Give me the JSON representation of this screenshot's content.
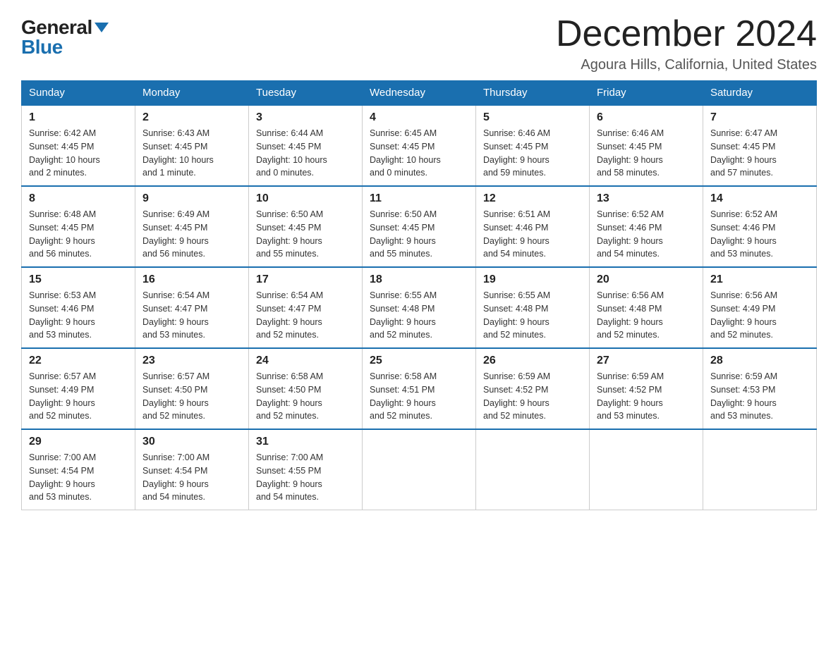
{
  "header": {
    "logo_general": "General",
    "logo_blue": "Blue",
    "title": "December 2024",
    "subtitle": "Agoura Hills, California, United States"
  },
  "days_of_week": [
    "Sunday",
    "Monday",
    "Tuesday",
    "Wednesday",
    "Thursday",
    "Friday",
    "Saturday"
  ],
  "weeks": [
    [
      {
        "day": "1",
        "sunrise": "6:42 AM",
        "sunset": "4:45 PM",
        "daylight": "10 hours",
        "daylight2": "and 2 minutes."
      },
      {
        "day": "2",
        "sunrise": "6:43 AM",
        "sunset": "4:45 PM",
        "daylight": "10 hours",
        "daylight2": "and 1 minute."
      },
      {
        "day": "3",
        "sunrise": "6:44 AM",
        "sunset": "4:45 PM",
        "daylight": "10 hours",
        "daylight2": "and 0 minutes."
      },
      {
        "day": "4",
        "sunrise": "6:45 AM",
        "sunset": "4:45 PM",
        "daylight": "10 hours",
        "daylight2": "and 0 minutes."
      },
      {
        "day": "5",
        "sunrise": "6:46 AM",
        "sunset": "4:45 PM",
        "daylight": "9 hours",
        "daylight2": "and 59 minutes."
      },
      {
        "day": "6",
        "sunrise": "6:46 AM",
        "sunset": "4:45 PM",
        "daylight": "9 hours",
        "daylight2": "and 58 minutes."
      },
      {
        "day": "7",
        "sunrise": "6:47 AM",
        "sunset": "4:45 PM",
        "daylight": "9 hours",
        "daylight2": "and 57 minutes."
      }
    ],
    [
      {
        "day": "8",
        "sunrise": "6:48 AM",
        "sunset": "4:45 PM",
        "daylight": "9 hours",
        "daylight2": "and 56 minutes."
      },
      {
        "day": "9",
        "sunrise": "6:49 AM",
        "sunset": "4:45 PM",
        "daylight": "9 hours",
        "daylight2": "and 56 minutes."
      },
      {
        "day": "10",
        "sunrise": "6:50 AM",
        "sunset": "4:45 PM",
        "daylight": "9 hours",
        "daylight2": "and 55 minutes."
      },
      {
        "day": "11",
        "sunrise": "6:50 AM",
        "sunset": "4:45 PM",
        "daylight": "9 hours",
        "daylight2": "and 55 minutes."
      },
      {
        "day": "12",
        "sunrise": "6:51 AM",
        "sunset": "4:46 PM",
        "daylight": "9 hours",
        "daylight2": "and 54 minutes."
      },
      {
        "day": "13",
        "sunrise": "6:52 AM",
        "sunset": "4:46 PM",
        "daylight": "9 hours",
        "daylight2": "and 54 minutes."
      },
      {
        "day": "14",
        "sunrise": "6:52 AM",
        "sunset": "4:46 PM",
        "daylight": "9 hours",
        "daylight2": "and 53 minutes."
      }
    ],
    [
      {
        "day": "15",
        "sunrise": "6:53 AM",
        "sunset": "4:46 PM",
        "daylight": "9 hours",
        "daylight2": "and 53 minutes."
      },
      {
        "day": "16",
        "sunrise": "6:54 AM",
        "sunset": "4:47 PM",
        "daylight": "9 hours",
        "daylight2": "and 53 minutes."
      },
      {
        "day": "17",
        "sunrise": "6:54 AM",
        "sunset": "4:47 PM",
        "daylight": "9 hours",
        "daylight2": "and 52 minutes."
      },
      {
        "day": "18",
        "sunrise": "6:55 AM",
        "sunset": "4:48 PM",
        "daylight": "9 hours",
        "daylight2": "and 52 minutes."
      },
      {
        "day": "19",
        "sunrise": "6:55 AM",
        "sunset": "4:48 PM",
        "daylight": "9 hours",
        "daylight2": "and 52 minutes."
      },
      {
        "day": "20",
        "sunrise": "6:56 AM",
        "sunset": "4:48 PM",
        "daylight": "9 hours",
        "daylight2": "and 52 minutes."
      },
      {
        "day": "21",
        "sunrise": "6:56 AM",
        "sunset": "4:49 PM",
        "daylight": "9 hours",
        "daylight2": "and 52 minutes."
      }
    ],
    [
      {
        "day": "22",
        "sunrise": "6:57 AM",
        "sunset": "4:49 PM",
        "daylight": "9 hours",
        "daylight2": "and 52 minutes."
      },
      {
        "day": "23",
        "sunrise": "6:57 AM",
        "sunset": "4:50 PM",
        "daylight": "9 hours",
        "daylight2": "and 52 minutes."
      },
      {
        "day": "24",
        "sunrise": "6:58 AM",
        "sunset": "4:50 PM",
        "daylight": "9 hours",
        "daylight2": "and 52 minutes."
      },
      {
        "day": "25",
        "sunrise": "6:58 AM",
        "sunset": "4:51 PM",
        "daylight": "9 hours",
        "daylight2": "and 52 minutes."
      },
      {
        "day": "26",
        "sunrise": "6:59 AM",
        "sunset": "4:52 PM",
        "daylight": "9 hours",
        "daylight2": "and 52 minutes."
      },
      {
        "day": "27",
        "sunrise": "6:59 AM",
        "sunset": "4:52 PM",
        "daylight": "9 hours",
        "daylight2": "and 53 minutes."
      },
      {
        "day": "28",
        "sunrise": "6:59 AM",
        "sunset": "4:53 PM",
        "daylight": "9 hours",
        "daylight2": "and 53 minutes."
      }
    ],
    [
      {
        "day": "29",
        "sunrise": "7:00 AM",
        "sunset": "4:54 PM",
        "daylight": "9 hours",
        "daylight2": "and 53 minutes."
      },
      {
        "day": "30",
        "sunrise": "7:00 AM",
        "sunset": "4:54 PM",
        "daylight": "9 hours",
        "daylight2": "and 54 minutes."
      },
      {
        "day": "31",
        "sunrise": "7:00 AM",
        "sunset": "4:55 PM",
        "daylight": "9 hours",
        "daylight2": "and 54 minutes."
      },
      null,
      null,
      null,
      null
    ]
  ]
}
